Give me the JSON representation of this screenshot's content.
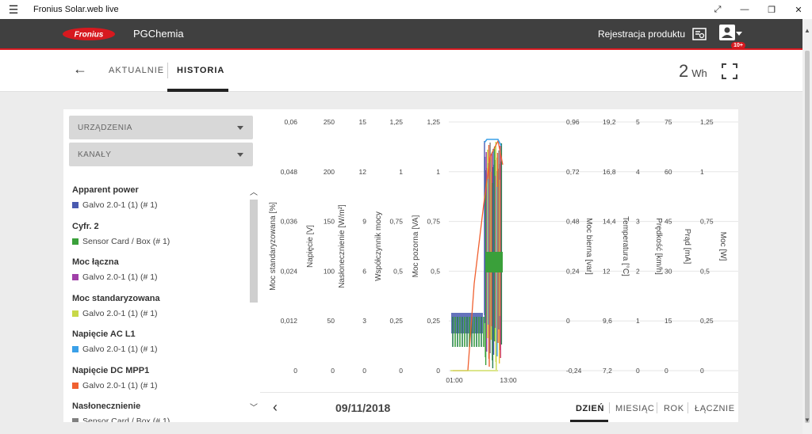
{
  "window": {
    "title": "Fronius Solar.web live"
  },
  "header": {
    "logo_text": "Fronius",
    "site_name": "PGChemia",
    "register_label": "Rejestracja produktu",
    "notifications_badge": "10+"
  },
  "tabs": {
    "current": "AKTUALNIE",
    "history": "HISTORIA"
  },
  "energy": {
    "value": "2",
    "unit": "Wh"
  },
  "filters": {
    "devices": "URZĄDZENIA",
    "channels": "KANAŁY"
  },
  "channels": [
    {
      "name": "Apparent power",
      "device": "Galvo 2.0-1 (1) (# 1)",
      "color": "#4a5ab0"
    },
    {
      "name": "Cyfr. 2",
      "device": "Sensor Card / Box (# 1)",
      "color": "#3aa03a"
    },
    {
      "name": "Moc łączna",
      "device": "Galvo 2.0-1 (1) (# 1)",
      "color": "#a040a8"
    },
    {
      "name": "Moc standaryzowana",
      "device": "Galvo 2.0-1 (1) (# 1)",
      "color": "#c8d848"
    },
    {
      "name": "Napięcie AC L1",
      "device": "Galvo 2.0-1 (1) (# 1)",
      "color": "#3aa0e8"
    },
    {
      "name": "Napięcie DC MPP1",
      "device": "Galvo 2.0-1 (1) (# 1)",
      "color": "#f06030"
    },
    {
      "name": "Nasłonecznienie",
      "device": "Sensor Card / Box (# 1)",
      "color": "#808080"
    }
  ],
  "navigation": {
    "date": "09/11/2018",
    "periods": [
      "DZIEŃ",
      "MIESIĄC",
      "ROK",
      "ŁĄCZNIE"
    ]
  },
  "chart_data": {
    "type": "line",
    "x_ticks": [
      "01:00",
      "13:00"
    ],
    "left_axes": [
      {
        "label": "Moc standaryzowana [%]",
        "ticks": [
          "0",
          "0,012",
          "0,024",
          "0,036",
          "0,048",
          "0,06"
        ]
      },
      {
        "label": "Napięcie [V]",
        "ticks": [
          "0",
          "50",
          "100",
          "150",
          "200",
          "250"
        ]
      },
      {
        "label": "Nasłonecznienie [W/m²]",
        "ticks": [
          "0",
          "3",
          "6",
          "9",
          "12",
          "15"
        ]
      },
      {
        "label": "Współczynnik mocy",
        "ticks": [
          "0",
          "0,25",
          "0,5",
          "0,75",
          "1",
          "1,25"
        ]
      },
      {
        "label": "Moc pozorna [VA]",
        "ticks": [
          "0",
          "0,25",
          "0,5",
          "0,75",
          "1",
          "1,25"
        ]
      }
    ],
    "right_axes": [
      {
        "label": "Moc bierna [var]",
        "ticks": [
          "-0,24",
          "0",
          "0,24",
          "0,48",
          "0,72",
          "0,96"
        ]
      },
      {
        "label": "Temperatura [°C]",
        "ticks": [
          "7,2",
          "9,6",
          "12",
          "14,4",
          "16,8",
          "19,2"
        ]
      },
      {
        "label": "Prędkość [km/h]",
        "ticks": [
          "0",
          "1",
          "2",
          "3",
          "4",
          "5"
        ]
      },
      {
        "label": "Prąd [mA]",
        "ticks": [
          "0",
          "15",
          "30",
          "45",
          "60",
          "75"
        ]
      },
      {
        "label": "Moc [W]",
        "ticks": [
          "0",
          "0,25",
          "0,5",
          "0,75",
          "1",
          "1,25"
        ]
      }
    ],
    "grid": true
  }
}
